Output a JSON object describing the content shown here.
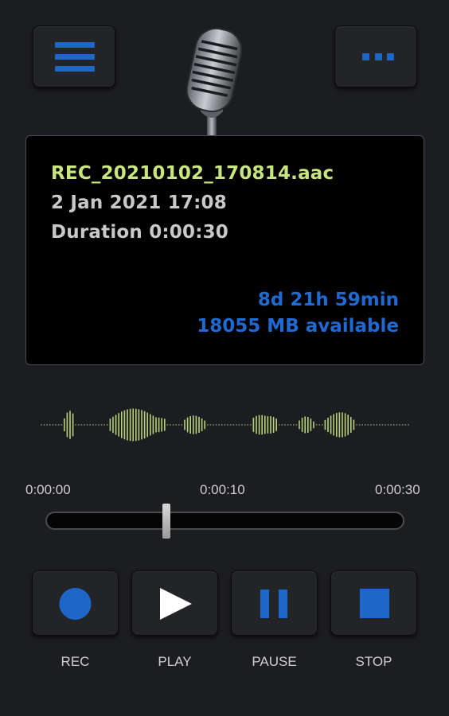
{
  "recording": {
    "filename": "REC_20210102_170814.aac",
    "datetime": "2 Jan 2021 17:08",
    "duration": "Duration 0:00:30"
  },
  "storage": {
    "remaining_time": "8d 21h 59min",
    "available": "18055 MB available"
  },
  "timeline": {
    "start": "0:00:00",
    "mid": "0:00:10",
    "end": "0:00:30",
    "position_fraction": 0.33
  },
  "controls": {
    "rec": "REC",
    "play": "PLAY",
    "pause": "PAUSE",
    "stop": "STOP"
  },
  "icons": {
    "menu": "hamburger-icon",
    "more": "more-dots-icon",
    "mic": "microphone-icon",
    "rec": "record-circle-icon",
    "play": "play-triangle-icon",
    "pause": "pause-bars-icon",
    "stop": "stop-square-icon"
  },
  "colors": {
    "accent_blue": "#1e66c8",
    "filename_green": "#c8e57e",
    "waveform_green": "#b8d27a",
    "text_gray": "#c9c9c9",
    "background": "#1c1d20"
  }
}
